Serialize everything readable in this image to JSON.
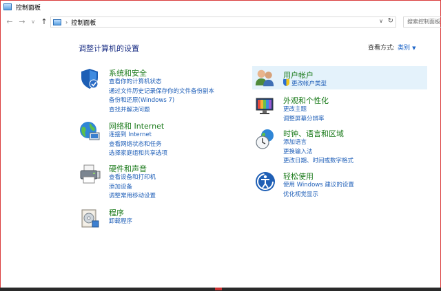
{
  "window": {
    "title": "控制面板"
  },
  "navbar": {
    "back": "←",
    "forward": "→",
    "recent": "∨",
    "up": "↑",
    "address_crumb": "控制面板",
    "address_dropdown": "∨",
    "refresh": "↻",
    "search_placeholder": "搜索控制面板"
  },
  "main": {
    "heading": "调整计算机的设置",
    "view_by_label": "查看方式:",
    "view_by_value": "类别",
    "view_by_caret": "▼"
  },
  "left_categories": [
    {
      "title": "系统和安全",
      "links": [
        "查看你的计算机状态",
        "通过文件历史记录保存你的文件备份副本",
        "备份和还原(Windows 7)",
        "查找并解决问题"
      ]
    },
    {
      "title": "网络和 Internet",
      "links": [
        "连接到 Internet",
        "查看网络状态和任务",
        "选择家庭组和共享选项"
      ]
    },
    {
      "title": "硬件和声音",
      "links": [
        "查看设备和打印机",
        "添加设备",
        "调整常用移动设置"
      ]
    },
    {
      "title": "程序",
      "links": [
        "卸载程序"
      ]
    }
  ],
  "right_categories": [
    {
      "title": "用户帐户",
      "links": [
        "更改帐户类型"
      ]
    },
    {
      "title": "外观和个性化",
      "links": [
        "更改主题",
        "调整屏幕分辨率"
      ]
    },
    {
      "title": "时钟、语言和区域",
      "links": [
        "添加语言",
        "更换输入法",
        "更改日期、时间或数字格式"
      ]
    },
    {
      "title": "轻松使用",
      "links": [
        "使用 Windows 建议的设置",
        "优化视觉显示"
      ]
    }
  ],
  "colors": {
    "heading": "#1e3287",
    "category_title": "#1a7a1a",
    "link": "#1f5fb8",
    "highlight": "#e4f2fb",
    "window_border": "#d93a3a"
  }
}
